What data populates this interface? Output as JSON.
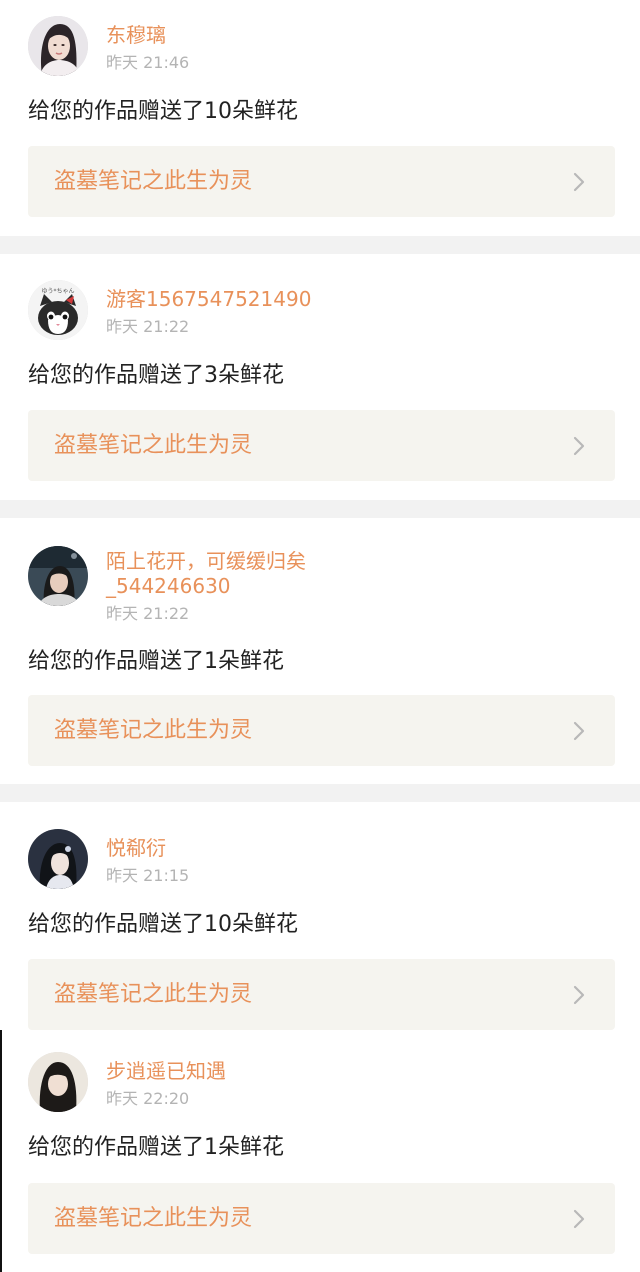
{
  "notifications": [
    {
      "username": "东穆璃",
      "time": "昨天 21:46",
      "message": "给您的作品赠送了10朵鲜花",
      "work_title": "盗墓笔记之此生为灵"
    },
    {
      "username": "游客1567547521490",
      "time": "昨天 21:22",
      "message": "给您的作品赠送了3朵鲜花",
      "work_title": "盗墓笔记之此生为灵"
    },
    {
      "username_line1": "陌上花开，可缓缓归矣",
      "username_line2": "_544246630",
      "time": "昨天 21:22",
      "message": "给您的作品赠送了1朵鲜花",
      "work_title": "盗墓笔记之此生为灵"
    },
    {
      "username": "悦郗衍",
      "time": "昨天 21:15",
      "message": "给您的作品赠送了10朵鲜花",
      "work_title": "盗墓笔记之此生为灵"
    },
    {
      "username": "步逍遥已知遇",
      "time": "昨天 22:20",
      "message": "给您的作品赠送了1朵鲜花",
      "work_title": "盗墓笔记之此生为灵"
    }
  ],
  "colors": {
    "accent": "#e8915a",
    "time_gray": "#b4b4b4",
    "card_bg": "#f5f4ef",
    "separator": "#f2f2f2"
  },
  "icons": {
    "card_arrow": "chevron-right-icon"
  },
  "avatar_cat_caption": "ゆう*ちゃん"
}
